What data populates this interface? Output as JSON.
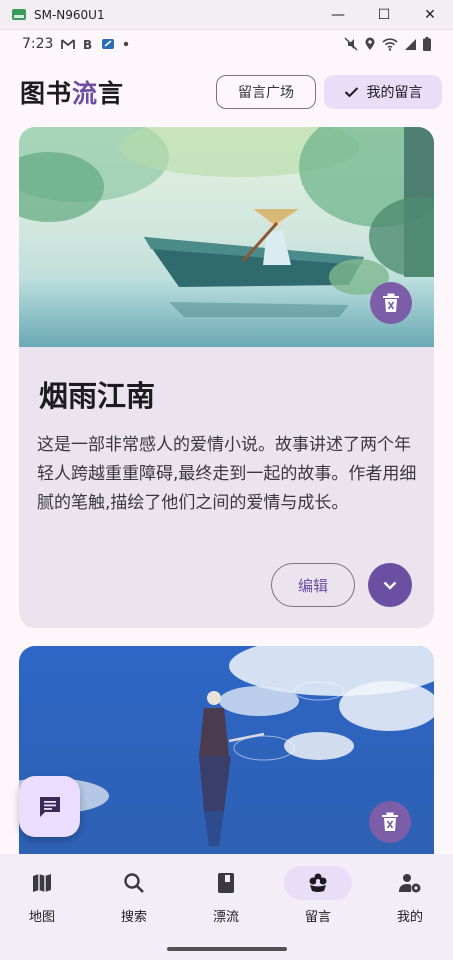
{
  "window": {
    "title": "SM-N960U1",
    "minimize": "—",
    "maximize": "☐",
    "close": "✕"
  },
  "status_bar": {
    "time": "7:23",
    "left_icons": [
      "gmail-icon",
      "b-icon",
      "news-icon",
      "dot-icon"
    ],
    "right_icons": [
      "mute-icon",
      "location-icon",
      "wifi-icon",
      "signal-icon",
      "battery-icon"
    ]
  },
  "header": {
    "title_part1": "图书",
    "title_part2": "流",
    "title_part3": "言",
    "square_button": "留言广场",
    "mine_button": "我的留言"
  },
  "cards": [
    {
      "title": "烟雨江南",
      "description": "这是一部非常感人的爱情小说。故事讲述了两个年轻人跨越重重障碍,最终走到一起的故事。作者用细腻的笔触,描绘了他们之间的爱情与成长。",
      "edit_label": "编辑",
      "cover": "girl rowing boat on lake illustration"
    },
    {
      "cover": "swordsman standing in water under blue sky illustration"
    }
  ],
  "bottom_nav": [
    {
      "label": "地图",
      "icon": "map-icon",
      "active": false
    },
    {
      "label": "搜索",
      "icon": "search-icon",
      "active": false
    },
    {
      "label": "漂流",
      "icon": "book-icon",
      "active": false
    },
    {
      "label": "留言",
      "icon": "flower-icon",
      "active": true
    },
    {
      "label": "我的",
      "icon": "person-settings-icon",
      "active": false
    }
  ],
  "colors": {
    "primary": "#6a4fa3",
    "card_bg": "#ebe4ee",
    "active_indicator": "#e8def8",
    "fab_bg": "#eaddff",
    "nav_bg": "#f3edf7"
  }
}
